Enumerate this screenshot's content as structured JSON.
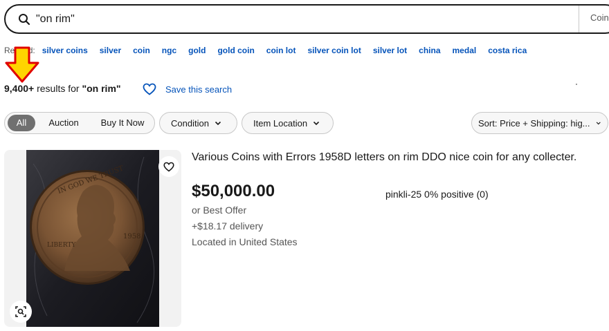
{
  "search": {
    "query": "\"on rim\"",
    "category": "Coin"
  },
  "related": {
    "label": "Related:",
    "links": [
      "silver coins",
      "silver",
      "coin",
      "ngc",
      "gold",
      "gold coin",
      "coin lot",
      "silver coin lot",
      "silver lot",
      "china",
      "medal",
      "costa rica"
    ]
  },
  "results": {
    "count": "9,400+",
    "middle": " results for ",
    "query": "\"on rim\"",
    "save_label": "Save this search"
  },
  "filters": {
    "buying_formats": [
      "All",
      "Auction",
      "Buy It Now"
    ],
    "selected_format": "All",
    "condition": "Condition",
    "location": "Item Location",
    "sort": "Sort: Price + Shipping: hig..."
  },
  "listing": {
    "title": "Various Coins with Errors 1958D letters on rim DDO nice coin for any collecter.",
    "price": "$50,000.00",
    "best_offer": "or Best Offer",
    "delivery": "+$18.17 delivery",
    "location": "Located in United States",
    "seller": "pinkli-25 0% positive (0)"
  },
  "colors": {
    "link": "#0654ba",
    "arrow_fill": "#ffd400",
    "arrow_stroke": "#e00000"
  },
  "icons": [
    "search-icon",
    "heart-icon",
    "chevron-down-icon",
    "visual-search-icon",
    "arrow-down-annotation"
  ]
}
